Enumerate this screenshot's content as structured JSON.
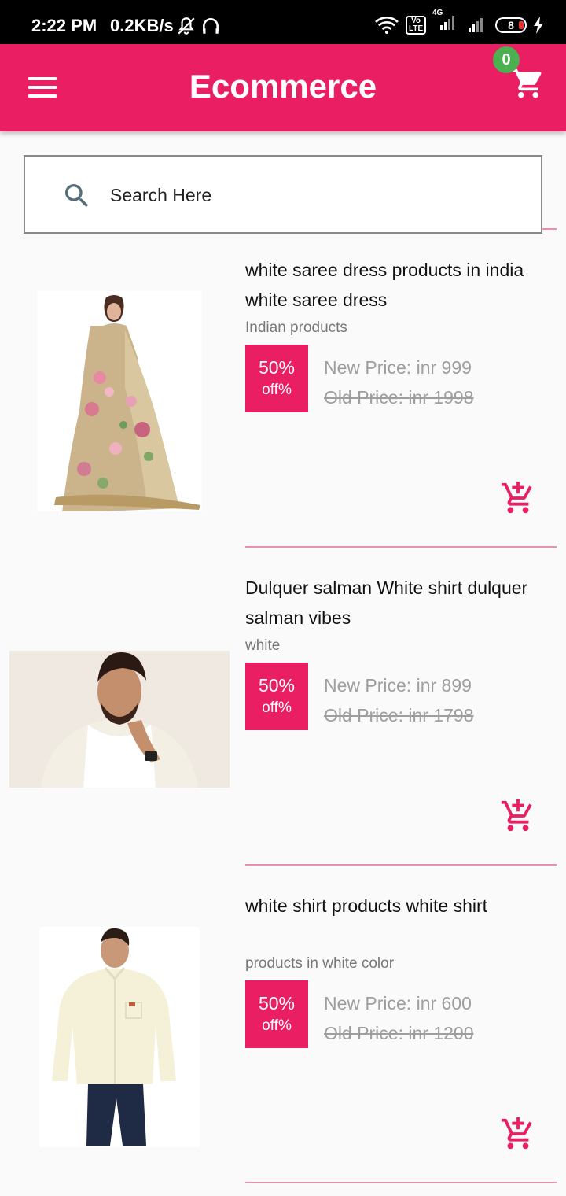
{
  "status_bar": {
    "time": "2:22 PM",
    "net_speed": "0.2KB/s",
    "network_label": "4G",
    "volte_label": "Vo LTE",
    "battery": "8"
  },
  "app_bar": {
    "title": "Ecommerce",
    "cart_count": "0"
  },
  "search": {
    "placeholder": "Search Here"
  },
  "colors": {
    "primary": "#e91e63",
    "badge": "#4caf50",
    "divider": "#e991ac"
  },
  "products": [
    {
      "title": "white saree dress products in india white saree dress",
      "subtitle": "Indian products",
      "discount": "50%",
      "discount_suffix": "off%",
      "new_price": "New Price: inr 999",
      "old_price": "Old Price: inr 1998"
    },
    {
      "title": "Dulquer salman White shirt dulquer salman vibes",
      "subtitle": "white",
      "discount": "50%",
      "discount_suffix": "off%",
      "new_price": "New Price: inr 899",
      "old_price": "Old Price: inr 1798"
    },
    {
      "title": "white shirt products white shirt",
      "subtitle": "products in white color",
      "discount": "50%",
      "discount_suffix": "off%",
      "new_price": "New Price: inr 600",
      "old_price": "Old Price: inr 1200"
    }
  ]
}
